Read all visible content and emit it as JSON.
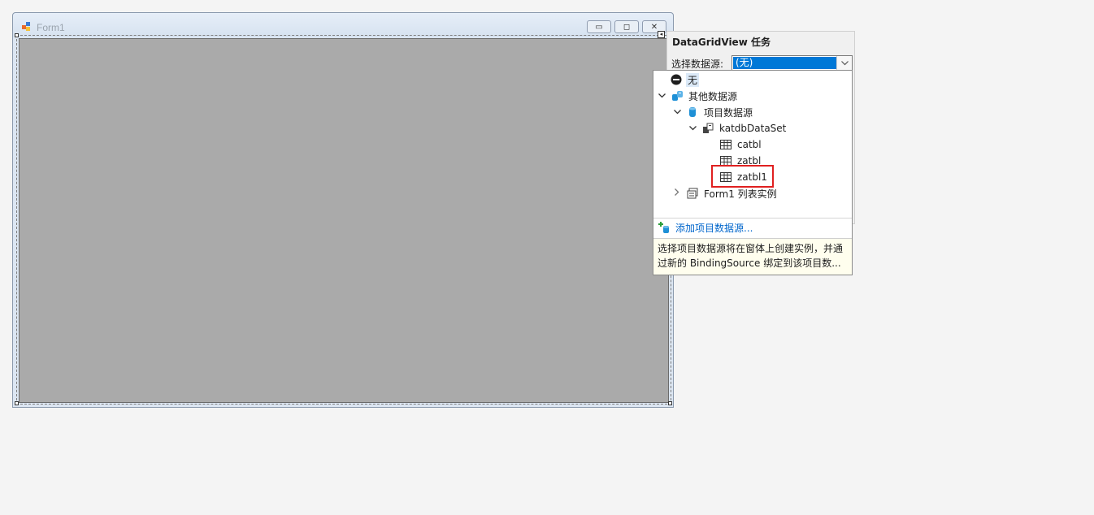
{
  "form": {
    "title": "Form1",
    "minimize_glyph": "▭",
    "restore_glyph": "◻",
    "close_glyph": "✕"
  },
  "smart_tag": {
    "header": "DataGridView 任务",
    "datasource_label": "选择数据源:",
    "datasource_value": "(无)"
  },
  "dropdown": {
    "none_label": "无",
    "other_sources_label": "其他数据源",
    "project_sources_label": "项目数据源",
    "dataset_label": "katdbDataSet",
    "tables": [
      "catbl",
      "zatbl",
      "zatbl1"
    ],
    "form_instances_label": "Form1 列表实例",
    "add_source_label": "添加项目数据源...",
    "help_text": "选择项目数据源将在窗体上创建实例，并通过新的 BindingSource 绑定到该项目数..."
  },
  "colors": {
    "selection_highlight": "#0078d7",
    "highlight_box": "#e02020",
    "link": "#0066cc",
    "db_icon": "#1e90d6"
  }
}
